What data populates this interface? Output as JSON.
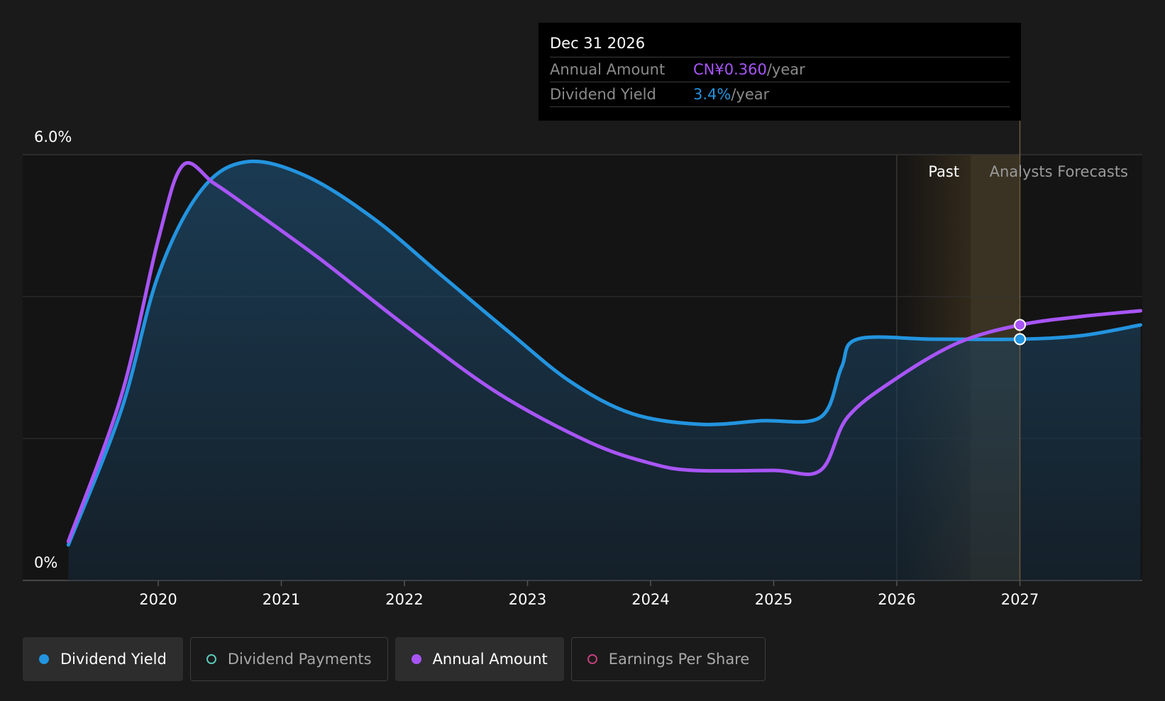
{
  "tooltip": {
    "date": "Dec 31 2026",
    "rows": [
      {
        "label": "Annual Amount",
        "value": "CN¥0.360",
        "unit": "/year",
        "color": "#a855f7"
      },
      {
        "label": "Dividend Yield",
        "value": "3.4%",
        "unit": "/year",
        "color": "#2394df"
      }
    ]
  },
  "region_labels": {
    "past": "Past",
    "forecast": "Analysts Forecasts"
  },
  "legend": [
    {
      "label": "Dividend Yield",
      "color": "#2394df",
      "active": true
    },
    {
      "label": "Dividend Payments",
      "color": "#5ac8b8",
      "active": false
    },
    {
      "label": "Annual Amount",
      "color": "#a855f7",
      "active": true
    },
    {
      "label": "Earnings Per Share",
      "color": "#c2407a",
      "active": false
    }
  ],
  "chart_data": {
    "type": "area",
    "ylim": [
      0,
      6.0
    ],
    "y_tick_labels": [
      "0%",
      "6.0%"
    ],
    "x_tick_labels": [
      "2020",
      "2021",
      "2022",
      "2023",
      "2024",
      "2025",
      "2026",
      "2027"
    ],
    "past_forecast_split": 2026.6,
    "tooltip_x": 2027.0,
    "series": [
      {
        "name": "Dividend Yield",
        "color": "#2394df",
        "filled": true,
        "points": [
          [
            2019.27,
            0.5
          ],
          [
            2019.7,
            2.4
          ],
          [
            2020.0,
            4.3
          ],
          [
            2020.35,
            5.5
          ],
          [
            2020.72,
            5.9
          ],
          [
            2021.2,
            5.7
          ],
          [
            2021.75,
            5.1
          ],
          [
            2022.3,
            4.3
          ],
          [
            2022.85,
            3.5
          ],
          [
            2023.35,
            2.8
          ],
          [
            2023.85,
            2.35
          ],
          [
            2024.4,
            2.2
          ],
          [
            2024.9,
            2.25
          ],
          [
            2025.38,
            2.3
          ],
          [
            2025.55,
            3.0
          ],
          [
            2025.68,
            3.4
          ],
          [
            2026.3,
            3.4
          ],
          [
            2027.0,
            3.4
          ],
          [
            2027.5,
            3.45
          ],
          [
            2027.98,
            3.6
          ]
        ]
      },
      {
        "name": "Annual Amount",
        "color": "#a855f7",
        "filled": false,
        "points": [
          [
            2019.27,
            0.55
          ],
          [
            2019.7,
            2.6
          ],
          [
            2020.0,
            4.8
          ],
          [
            2020.2,
            5.85
          ],
          [
            2020.45,
            5.6
          ],
          [
            2020.7,
            5.3
          ],
          [
            2021.3,
            4.55
          ],
          [
            2022.0,
            3.6
          ],
          [
            2022.75,
            2.65
          ],
          [
            2023.5,
            1.95
          ],
          [
            2024.0,
            1.65
          ],
          [
            2024.35,
            1.55
          ],
          [
            2025.0,
            1.55
          ],
          [
            2025.38,
            1.55
          ],
          [
            2025.6,
            2.3
          ],
          [
            2026.0,
            2.85
          ],
          [
            2026.5,
            3.35
          ],
          [
            2027.0,
            3.6
          ],
          [
            2027.5,
            3.72
          ],
          [
            2027.98,
            3.8
          ]
        ]
      }
    ]
  }
}
